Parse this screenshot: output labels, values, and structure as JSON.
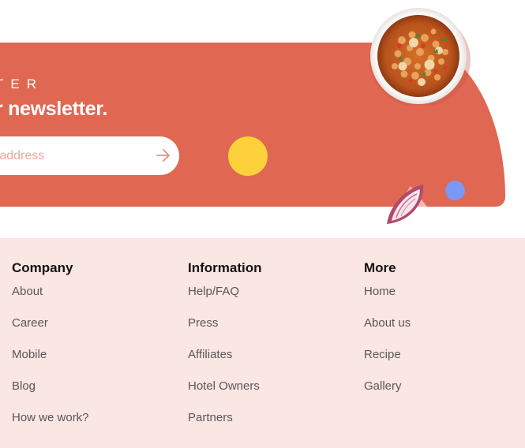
{
  "newsletter": {
    "eyebrow": "TER",
    "headline": "r newsletter.",
    "email_placeholder": "ail-address",
    "send_icon": "arrow-right-icon"
  },
  "decor": {
    "bowl_image": "curry-bowl-illustration",
    "onion_image": "onion-slice-illustration"
  },
  "footer": {
    "columns": [
      {
        "title": "Company",
        "items": [
          "About",
          "Career",
          "Mobile",
          "Blog",
          "How we work?"
        ]
      },
      {
        "title": "Information",
        "items": [
          "Help/FAQ",
          "Press",
          "Affiliates",
          "Hotel Owners",
          "Partners"
        ]
      },
      {
        "title": "More",
        "items": [
          "Home",
          "About us",
          "Recipe",
          "Gallery"
        ]
      }
    ]
  },
  "colors": {
    "banner": "#E06751",
    "footer_bg": "#FAE6E2",
    "yellow_accent": "#FDD13A",
    "blue_accent": "#7B98F6"
  }
}
